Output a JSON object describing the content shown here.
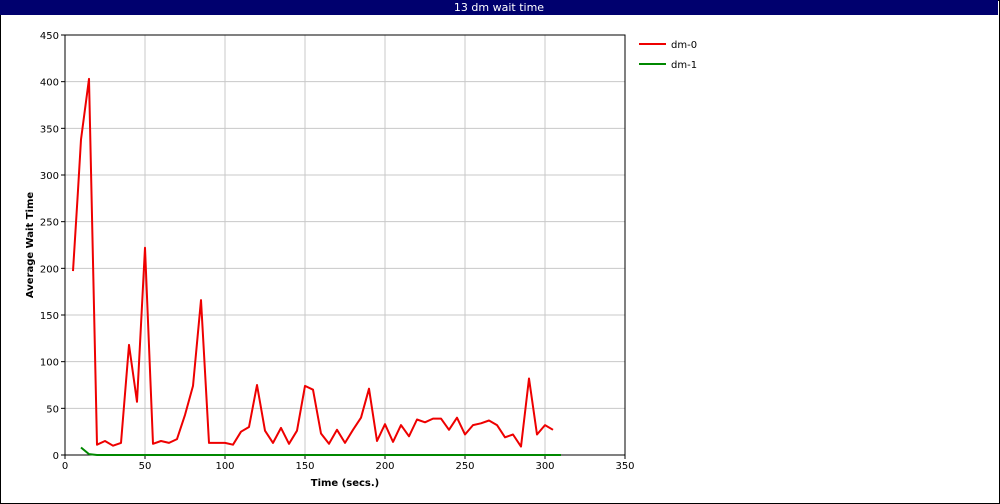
{
  "window": {
    "title": "13 dm wait time"
  },
  "chart_data": {
    "type": "line",
    "title": "13 dm wait time",
    "xlabel": "Time (secs.)",
    "ylabel": "Average Wait Time",
    "xlim": [
      0,
      350
    ],
    "ylim": [
      0,
      450
    ],
    "xticks": [
      0,
      50,
      100,
      150,
      200,
      250,
      300,
      350
    ],
    "yticks": [
      0,
      50,
      100,
      150,
      200,
      250,
      300,
      350,
      400,
      450
    ],
    "grid": true,
    "legend_position": "top-right, outside plot",
    "series": [
      {
        "name": "dm-0",
        "color": "#ee0000",
        "x": [
          5,
          8,
          10,
          15,
          20,
          25,
          30,
          35,
          40,
          45,
          50,
          55,
          60,
          65,
          70,
          75,
          80,
          85,
          90,
          95,
          100,
          105,
          110,
          115,
          120,
          125,
          130,
          135,
          140,
          145,
          150,
          155,
          160,
          165,
          170,
          175,
          180,
          185,
          190,
          195,
          200,
          205,
          210,
          215,
          220,
          225,
          230,
          235,
          240,
          245,
          250,
          255,
          260,
          265,
          270,
          275,
          280,
          285,
          290,
          295,
          300,
          305
        ],
        "y": [
          197,
          280,
          338,
          403,
          11,
          15,
          10,
          13,
          118,
          57,
          222,
          12,
          15,
          13,
          17,
          43,
          74,
          166,
          13,
          13,
          13,
          11,
          25,
          30,
          75,
          26,
          13,
          29,
          12,
          26,
          74,
          70,
          23,
          12,
          27,
          13,
          27,
          40,
          71,
          15,
          33,
          14,
          32,
          20,
          38,
          35,
          39,
          39,
          27,
          40,
          22,
          32,
          34,
          37,
          32,
          19,
          22,
          9,
          82,
          22,
          32,
          27
        ]
      },
      {
        "name": "dm-1",
        "color": "#008800",
        "x": [
          10,
          15,
          20,
          30,
          50,
          100,
          150,
          200,
          250,
          300,
          310
        ],
        "y": [
          8,
          1,
          0,
          0,
          0,
          0,
          0,
          0,
          0,
          0,
          0
        ]
      }
    ]
  }
}
